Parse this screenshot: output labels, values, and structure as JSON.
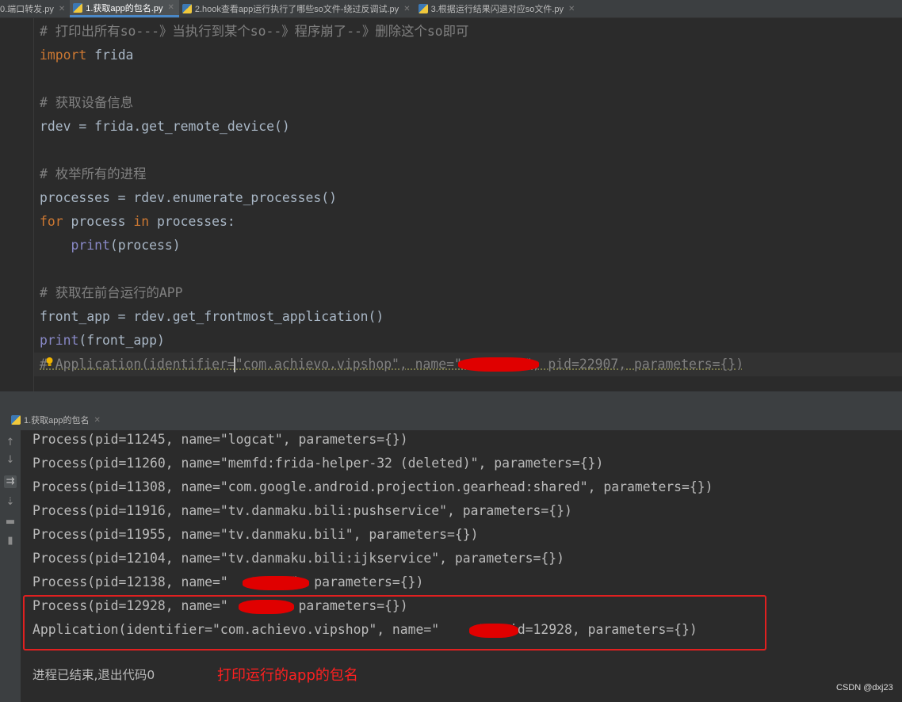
{
  "tabs": [
    {
      "label": "0.端口转发.py",
      "active": false
    },
    {
      "label": "1.获取app的包名.py",
      "active": true
    },
    {
      "label": "2.hook查看app运行执行了哪些so文件-绕过反调试.py",
      "active": false
    },
    {
      "label": "3.根据运行结果闪退对应so文件.py",
      "active": false
    }
  ],
  "editor": {
    "lines": [
      "# 打印出所有so---》当执行到某个so--》程序崩了--》删除这个so即可",
      "import frida",
      "",
      "# 获取设备信息",
      "rdev = frida.get_remote_device()",
      "",
      "# 枚举所有的进程",
      "processes = rdev.enumerate_processes()",
      "for process in processes:",
      "    print(process)",
      "",
      "# 获取在前台运行的APP",
      "front_app = rdev.get_frontmost_application()",
      "print(front_app)",
      "# Application(identifier=\"com.achievo.vipshop\", name=\"        \", pid=22907, parameters={})"
    ]
  },
  "run_panel": {
    "tab_label": "1.获取app的包名",
    "output": [
      "Process(pid=11245, name=\"logcat\", parameters={})",
      "Process(pid=11260, name=\"memfd:frida-helper-32 (deleted)\", parameters={})",
      "Process(pid=11308, name=\"com.google.android.projection.gearhead:shared\", parameters={})",
      "Process(pid=11916, name=\"tv.danmaku.bili:pushservice\", parameters={})",
      "Process(pid=11955, name=\"tv.danmaku.bili\", parameters={})",
      "Process(pid=12104, name=\"tv.danmaku.bili:ijkservice\", parameters={})",
      "Process(pid=12138, name=\"        \", parameters={})",
      "Process(pid=12928, name=\"      \", parameters={})",
      "Application(identifier=\"com.achievo.vipshop\", name=\"     \", pid=12928, parameters={})"
    ],
    "exit_message": "进程已结束,退出代码0",
    "annotation": "打印运行的app的包名"
  },
  "watermark": "CSDN @dxj23",
  "colors": {
    "annotation": "#ff2020",
    "box": "#e02020",
    "keyword": "#cc7832",
    "comment": "#808080",
    "text": "#a9b7c6"
  }
}
